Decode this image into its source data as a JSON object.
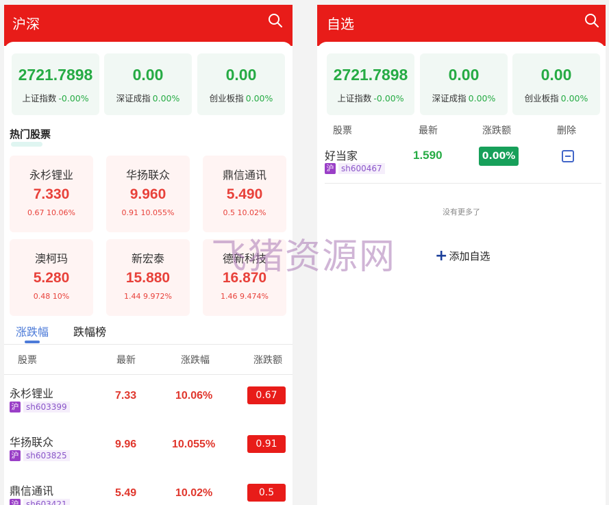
{
  "left": {
    "title": "沪深",
    "indices": [
      {
        "value": "2721.7898",
        "name": "上证指数",
        "change": "-0.00%"
      },
      {
        "value": "0.00",
        "name": "深证成指",
        "change": "0.00%"
      },
      {
        "value": "0.00",
        "name": "创业板指",
        "change": "0.00%"
      }
    ],
    "hot_title": "热门股票",
    "hot": [
      {
        "name": "永杉锂业",
        "price": "7.330",
        "change": "0.67 10.06%"
      },
      {
        "name": "华扬联众",
        "price": "9.960",
        "change": "0.91 10.055%"
      },
      {
        "name": "鼎信通讯",
        "price": "5.490",
        "change": "0.5 10.02%"
      },
      {
        "name": "澳柯玛",
        "price": "5.280",
        "change": "0.48 10%"
      },
      {
        "name": "新宏泰",
        "price": "15.880",
        "change": "1.44 9.972%"
      },
      {
        "name": "德新科技",
        "price": "16.870",
        "change": "1.46 9.474%"
      }
    ],
    "tabs": {
      "up": "涨跌幅",
      "down": "跌幅榜"
    },
    "table_headers": [
      "股票",
      "最新",
      "涨跌幅",
      "涨跌额"
    ],
    "rows": [
      {
        "name": "永杉锂业",
        "market": "沪",
        "code": "sh603399",
        "last": "7.33",
        "pct": "10.06%",
        "amt": "0.67"
      },
      {
        "name": "华扬联众",
        "market": "沪",
        "code": "sh603825",
        "last": "9.96",
        "pct": "10.055%",
        "amt": "0.91"
      },
      {
        "name": "鼎信通讯",
        "market": "沪",
        "code": "sh603421",
        "last": "5.49",
        "pct": "10.02%",
        "amt": "0.5"
      }
    ]
  },
  "right": {
    "title": "自选",
    "indices": [
      {
        "value": "2721.7898",
        "name": "上证指数",
        "change": "-0.00%"
      },
      {
        "value": "0.00",
        "name": "深证成指",
        "change": "0.00%"
      },
      {
        "value": "0.00",
        "name": "创业板指",
        "change": "0.00%"
      }
    ],
    "table_headers": [
      "股票",
      "最新",
      "涨跌额",
      "删除"
    ],
    "rows": [
      {
        "name": "好当家",
        "market": "沪",
        "code": "sh600467",
        "last": "1.590",
        "change": "0.00%"
      }
    ],
    "no_more": "没有更多了",
    "add_label": "添加自选"
  },
  "watermark": "飞猪资源网",
  "colors": {
    "brand_red": "#e81c19",
    "up_red": "#e0362c",
    "down_green": "#26ab44",
    "tab_blue": "#4d7bd8"
  },
  "icons": {
    "search": "search-icon",
    "delete": "minus-square-icon",
    "add": "plus-icon"
  }
}
